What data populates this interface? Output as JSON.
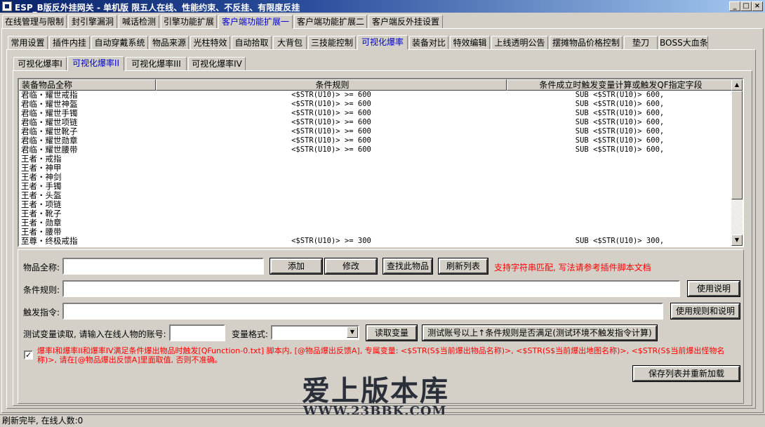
{
  "window": {
    "title": "ESP_B版反外挂网关 - 单机版 限五人在线、性能约束、不反挂、有限度反挂",
    "minimize": "_",
    "maximize": "□",
    "close": "×"
  },
  "main_tabs": [
    {
      "label": "在线管理与限制"
    },
    {
      "label": "封引擎漏洞"
    },
    {
      "label": "喊话检测"
    },
    {
      "label": "引擎功能扩展"
    },
    {
      "label": "客户端功能扩展一"
    },
    {
      "label": "客户端功能扩展二"
    },
    {
      "label": "客户端反外挂设置"
    }
  ],
  "sub_tabs": [
    {
      "label": "常用设置"
    },
    {
      "label": "插件内挂"
    },
    {
      "label": "自动穿戴系统"
    },
    {
      "label": "物品来源"
    },
    {
      "label": "光柱特效"
    },
    {
      "label": "自动拾取"
    },
    {
      "label": "大背包"
    },
    {
      "label": "三技能控制"
    },
    {
      "label": "可视化爆率"
    },
    {
      "label": "装备对比"
    },
    {
      "label": "特效编辑"
    },
    {
      "label": "上线透明公告"
    },
    {
      "label": "摆摊物品价格控制"
    },
    {
      "label": "垫刀"
    },
    {
      "label": "BOSS大血条"
    }
  ],
  "rate_tabs": [
    {
      "label": "可视化爆率I"
    },
    {
      "label": "可视化爆率II"
    },
    {
      "label": "可视化爆率III"
    },
    {
      "label": "可视化爆率IV"
    }
  ],
  "table": {
    "columns": [
      "装备物品全称",
      "条件规则",
      "条件成立时触发变量计算或触发QF指定字段"
    ],
    "rows": [
      [
        "君临・耀世戒指",
        "<$STR(U10)> >= 600",
        "SUB <$STR(U10)> 600,"
      ],
      [
        "君临・耀世神盔",
        "<$STR(U10)> >= 600",
        "SUB <$STR(U10)> 600,"
      ],
      [
        "君临・耀世手镯",
        "<$STR(U10)> >= 600",
        "SUB <$STR(U10)> 600,"
      ],
      [
        "君临・耀世项链",
        "<$STR(U10)> >= 600",
        "SUB <$STR(U10)> 600,"
      ],
      [
        "君临・耀世靴子",
        "<$STR(U10)> >= 600",
        "SUB <$STR(U10)> 600,"
      ],
      [
        "君临・耀世勋章",
        "<$STR(U10)> >= 600",
        "SUB <$STR(U10)> 600,"
      ],
      [
        "君临・耀世腰带",
        "<$STR(U10)> >= 600",
        "SUB <$STR(U10)> 600,"
      ],
      [
        "王者・戒指",
        "",
        ""
      ],
      [
        "王者・神甲",
        "",
        ""
      ],
      [
        "王者・神剑",
        "",
        ""
      ],
      [
        "王者・手镯",
        "",
        ""
      ],
      [
        "王者・头盔",
        "",
        ""
      ],
      [
        "王者・项链",
        "",
        ""
      ],
      [
        "王者・靴子",
        "",
        ""
      ],
      [
        "王者・勋章",
        "",
        ""
      ],
      [
        "王者・腰带",
        "",
        ""
      ],
      [
        "至尊・终极戒指",
        "<$STR(U10)> >= 300",
        "SUB <$STR(U10)> 300,"
      ]
    ]
  },
  "form": {
    "item_name_label": "物品全称:",
    "item_name_value": "",
    "add_button": "添加",
    "modify_button": "修改",
    "find_button": "查找此物品",
    "refresh_button": "刷新列表",
    "hint_text": "支持字符串匹配, 写法请参考插件脚本文档",
    "condition_label": "条件规则:",
    "condition_value": "",
    "usage_button": "使用说明",
    "trigger_label": "触发指令:",
    "trigger_value": "",
    "rules_usage_button": "使用规则和说明",
    "test_label": "测试变量读取, 请输入在线人物的账号:",
    "test_account_value": "",
    "var_format_label": "变量格式:",
    "var_format_value": "",
    "read_var_button": "读取变量",
    "test_rules_button": "测试账号以上↑条件规则是否满足(测试环境不触发指令计算)",
    "checkbox_checked": true,
    "note_text": "爆率I和爆率II和爆率IV满足条件爆出物品时触发[QFunction-0.txt] 脚本内, [@物品爆出反馈A], 专属变量: <$STR(S$当前爆出物品名称)>, <$STR(S$当前爆出地图名称)>, <$STR(S$当前爆出怪物名称)>, 请在[@物品爆出反馈A]里面取值, 否则不准确。",
    "save_button": "保存列表并重新加载"
  },
  "watermark": {
    "title": "爱上版本库",
    "url": "WWW.23BBK.COM"
  },
  "status": {
    "text": "刷新完毕, 在线人数:0"
  }
}
